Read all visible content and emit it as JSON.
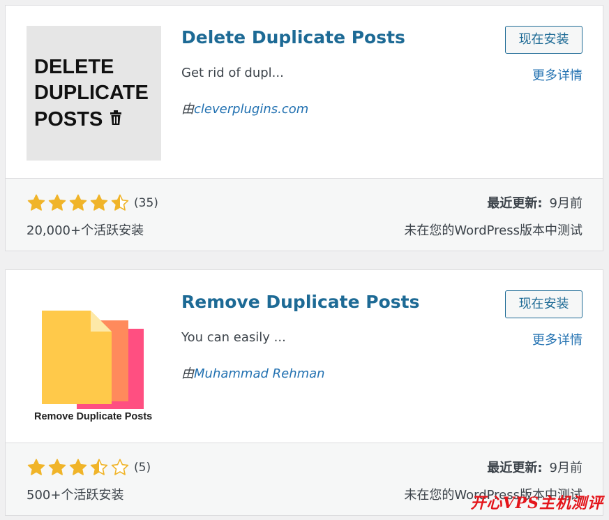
{
  "plugins": [
    {
      "title": "Delete Duplicate Posts",
      "description": "Get rid of dupl...",
      "author_prefix": "由",
      "author": "cleverplugins.com",
      "install_label": "现在安装",
      "details_label": "更多详情",
      "rating": 4.5,
      "rating_count": "(35)",
      "installs": "20,000+个活跃安装",
      "updated_label": "最近更新:",
      "updated_value": "9月前",
      "compat": "未在您的WordPress版本中测试",
      "thumb": {
        "lines": [
          "DELETE",
          "DUPLICATE",
          "POSTS"
        ],
        "icon": "trash-icon",
        "bg": "#e6e6e6"
      }
    },
    {
      "title": "Remove Duplicate Posts",
      "description": "You can easily ...",
      "author_prefix": "由",
      "author": "Muhammad Rehman",
      "install_label": "现在安装",
      "details_label": "更多详情",
      "rating": 3.5,
      "rating_count": "(5)",
      "installs": "500+个活跃安装",
      "updated_label": "最近更新:",
      "updated_value": "9月前",
      "compat": "未在您的WordPress版本中测试",
      "thumb": {
        "caption": "Remove Duplicate Posts",
        "icon": "stacked-documents-icon",
        "colors": [
          "#ff4f81",
          "#ff8a5c",
          "#ffc94a",
          "#fde9a8"
        ]
      }
    }
  ],
  "watermark": "开心VPS主机测评",
  "colors": {
    "link": "#2271b1",
    "title": "#1d6a95",
    "star": "#f0b429",
    "text": "#3c434a"
  }
}
